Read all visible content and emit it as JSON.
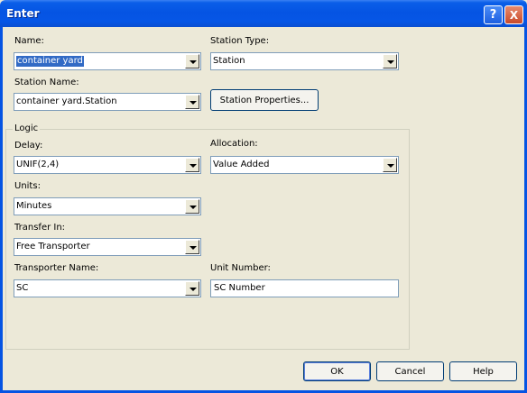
{
  "window": {
    "title": "Enter"
  },
  "titlebar_buttons": {
    "help": "?",
    "close": "X"
  },
  "fields": {
    "name": {
      "label": "Name:",
      "value": "container yard"
    },
    "station_type": {
      "label": "Station Type:",
      "value": "Station"
    },
    "station_name": {
      "label": "Station Name:",
      "value": "container yard.Station"
    },
    "station_properties": {
      "label": "Station Properties..."
    }
  },
  "logic": {
    "legend": "Logic",
    "delay": {
      "label": "Delay:",
      "value": "UNIF(2,4)"
    },
    "allocation": {
      "label": "Allocation:",
      "value": "Value Added"
    },
    "units": {
      "label": "Units:",
      "value": "Minutes"
    },
    "transfer_in": {
      "label": "Transfer In:",
      "value": "Free Transporter"
    },
    "transporter_name": {
      "label": "Transporter Name:",
      "value": "SC"
    },
    "unit_number": {
      "label": "Unit Number:",
      "value": "SC Number"
    }
  },
  "buttons": {
    "ok": "OK",
    "cancel": "Cancel",
    "help": "Help"
  }
}
